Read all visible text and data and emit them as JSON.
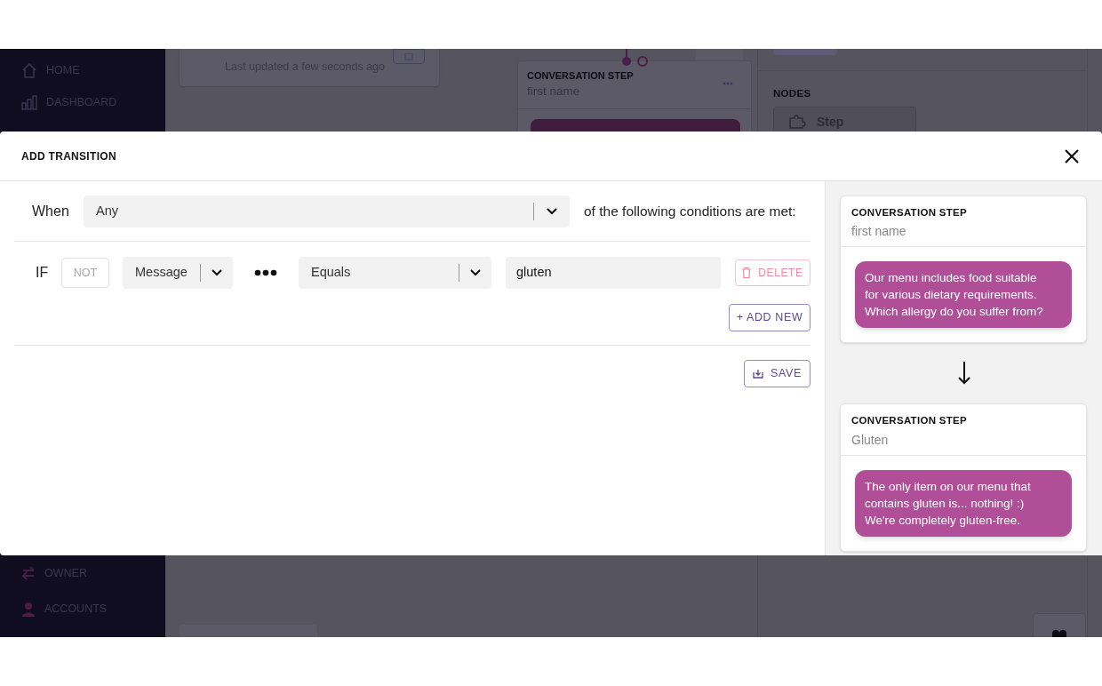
{
  "sidebar": {
    "items": [
      {
        "kind": "home",
        "label": "HOME"
      },
      {
        "kind": "chart",
        "label": "DASHBOARD"
      },
      {
        "kind": "swap",
        "label": "OWNER"
      },
      {
        "kind": "person",
        "label": "ACCOUNTS"
      }
    ]
  },
  "header_card": {
    "subtitle": "Last updated a few seconds ago"
  },
  "canvas_step": {
    "title": "CONVERSATION STEP",
    "name": "first name"
  },
  "nodes_panel": {
    "title": "NODES",
    "items": [
      "Step"
    ]
  },
  "modal": {
    "title": "ADD TRANSITION",
    "when_label": "When",
    "match_select": "Any",
    "match_suffix": "of the following conditions are met:",
    "conditions": [
      {
        "if_label": "IF",
        "not_label": "NOT",
        "not_on": false,
        "field": "Message",
        "operator": "Equals",
        "value": "gluten",
        "delete_label": "DELETE"
      }
    ],
    "add_label": "+ ADD NEW",
    "save_label": "SAVE"
  },
  "preview": {
    "steps": [
      {
        "title": "CONVERSATION STEP",
        "name": "first name",
        "message": "Our menu includes food suitable for various dietary requirements. Which allergy do you suffer from?"
      },
      {
        "title": "CONVERSATION STEP",
        "name": "Gluten",
        "message": "The only item on our menu that contains gluten is... nothing! :) We're completely gluten-free."
      }
    ]
  }
}
